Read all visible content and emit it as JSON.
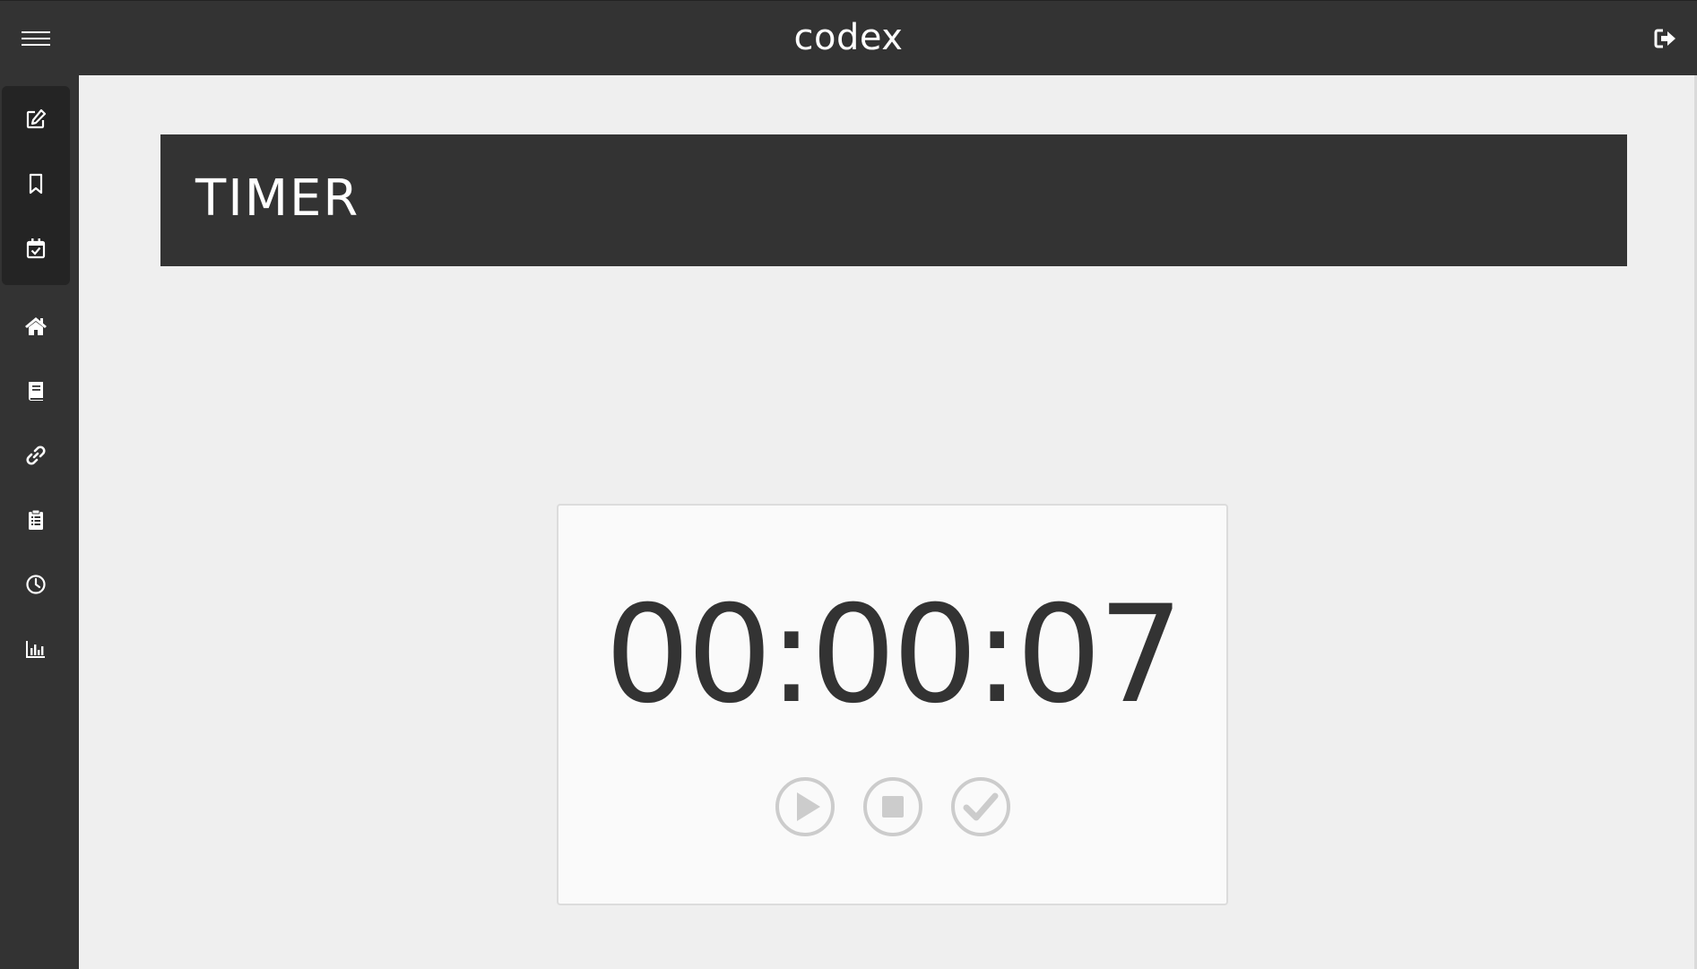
{
  "header": {
    "brand": "codex",
    "menu_icon": "hamburger-menu-icon",
    "logout_icon": "sign-out-icon"
  },
  "sidebar": {
    "grouped_items": [
      {
        "icon": "edit-icon"
      },
      {
        "icon": "bookmark-icon"
      },
      {
        "icon": "calendar-check-icon"
      }
    ],
    "items": [
      {
        "icon": "home-icon"
      },
      {
        "icon": "book-icon"
      },
      {
        "icon": "link-icon"
      },
      {
        "icon": "clipboard-icon"
      },
      {
        "icon": "clock-icon"
      },
      {
        "icon": "bar-chart-icon"
      }
    ]
  },
  "main": {
    "page_title": "TIMER",
    "timer": {
      "display": "00:00:07",
      "controls": [
        {
          "icon": "play-icon"
        },
        {
          "icon": "stop-icon"
        },
        {
          "icon": "check-icon"
        }
      ]
    }
  },
  "colors": {
    "bar": "#333333",
    "sidebar_group": "#242424",
    "background": "#efefef",
    "card": "#fafafa",
    "control_icon": "#cccccc",
    "text_light": "#ffffff",
    "text_dark": "#333333"
  }
}
